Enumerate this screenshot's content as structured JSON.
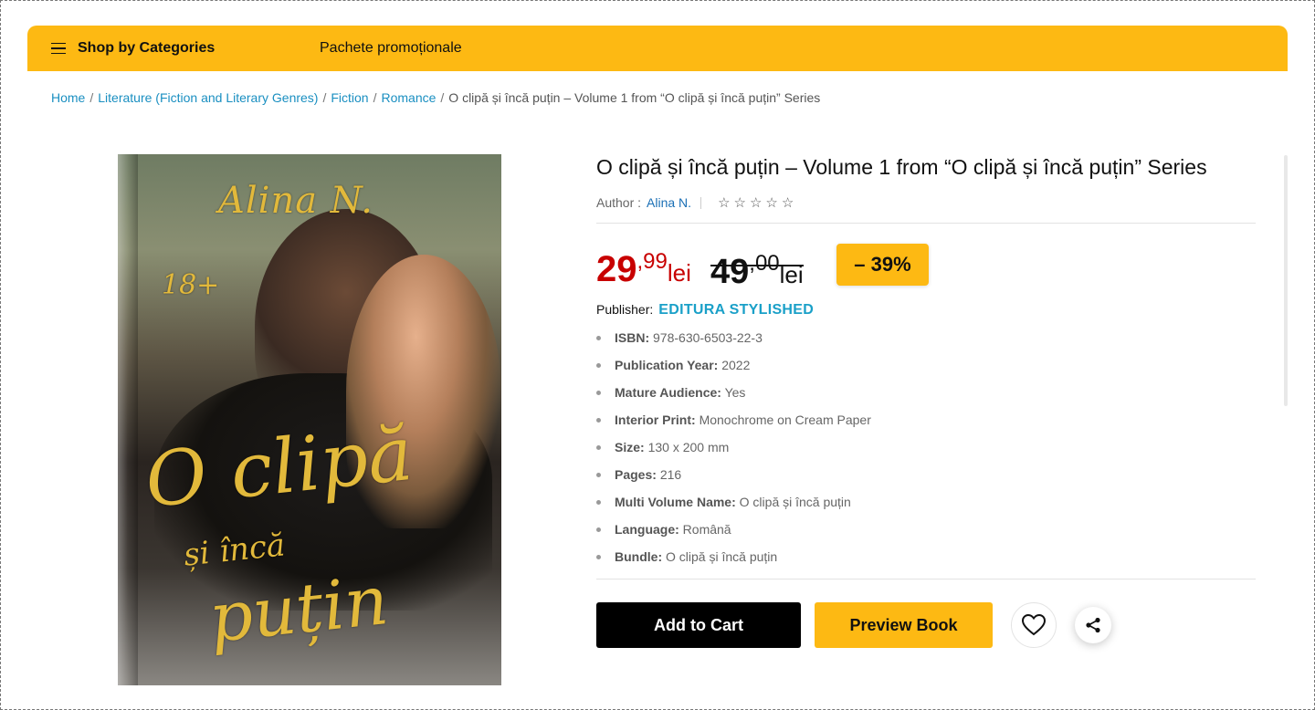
{
  "nav": {
    "categories_label": "Shop by Categories",
    "promo_label": "Pachete promoționale"
  },
  "breadcrumb": {
    "items": [
      "Home",
      "Literature (Fiction and Literary Genres)",
      "Fiction",
      "Romance"
    ],
    "current": "O clipă și încă puțin – Volume 1 from “O clipă și încă puțin” Series",
    "separator": "/"
  },
  "cover": {
    "author_script": "Alina N.",
    "age_rating": "18+",
    "title_line1": "O clipă",
    "title_line2": "și încă",
    "title_line3": "puțin"
  },
  "product": {
    "title": "O clipă și încă puțin – Volume 1 from “O clipă și încă puțin” Series",
    "author_label": "Author :",
    "author_name": "Alina N.",
    "rating": 0,
    "rating_max": 5,
    "price_new": {
      "int": "29",
      "dec": ",99",
      "currency": "lei"
    },
    "price_old": {
      "int": "49",
      "dec": ",00",
      "currency": "lei"
    },
    "discount": "– 39%",
    "publisher_label": "Publisher:",
    "publisher_name": "EDITURA STYLISHED",
    "specs": [
      {
        "label": "ISBN:",
        "value": "978-630-6503-22-3"
      },
      {
        "label": "Publication Year:",
        "value": "2022"
      },
      {
        "label": "Mature Audience:",
        "value": "Yes"
      },
      {
        "label": "Interior Print:",
        "value": "Monochrome on Cream Paper"
      },
      {
        "label": "Size:",
        "value": "130 x 200 mm"
      },
      {
        "label": "Pages:",
        "value": "216"
      },
      {
        "label": "Multi Volume Name:",
        "value": "O clipă și încă puțin"
      },
      {
        "label": "Language:",
        "value": "Română"
      },
      {
        "label": "Bundle:",
        "value": "O clipă și încă puțin"
      }
    ]
  },
  "actions": {
    "add_to_cart": "Add to Cart",
    "preview": "Preview Book",
    "wishlist_icon": "heart-icon",
    "share_icon": "share-icon"
  },
  "colors": {
    "accent_yellow": "#fdb913",
    "price_red": "#c80000",
    "link_blue": "#1a8fc1",
    "publisher_blue": "#1aa0c8"
  }
}
